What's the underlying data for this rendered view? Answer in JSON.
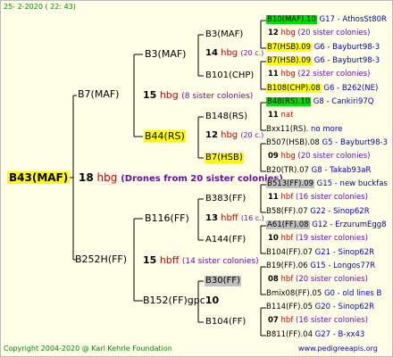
{
  "header": {
    "date": "25-  2-2020 (  22: 43)"
  },
  "footer": {
    "copyright": "Copyright 2004-2020 @ Karl Kehrle Foundation",
    "website": "www.pedigreeapis.org"
  },
  "colors": {
    "yellow": "#ffff00",
    "green": "#00dd00",
    "gray": "#c0c0c0",
    "line": "#000000"
  },
  "root": {
    "name": "B43(MAF)",
    "num": "18",
    "hbg": "hbg",
    "note": "(Drones from 20 sister colonies)"
  },
  "gen1": {
    "top": {
      "name": "B7(MAF)",
      "num": "15",
      "hbg": "hbg",
      "note": "(8 sister colonies)"
    },
    "bottom": {
      "name": "B252H(FF)",
      "num": "15",
      "hbg": "hbff",
      "note": "(14 sister colonies)"
    }
  },
  "gen2": {
    "a": {
      "name": "B3(MAF)",
      "num": "14",
      "hbg": "hbg",
      "note": "(20 c.)"
    },
    "b": {
      "name": "B44(RS)",
      "num": "12",
      "hbg": "hbg",
      "note": "(20 c.)"
    },
    "c": {
      "name": "B116(FF)",
      "num": "13",
      "hbg": "hbff",
      "note": "(16 c.)"
    },
    "d": {
      "name": "B152(FF)gpc",
      "num": "10"
    }
  },
  "gen3": {
    "a1": "B3(MAF)",
    "a2": "B101(CHP)",
    "b1": "B148(RS)",
    "b2": "B7(HSB)",
    "c1": "B383(FF)",
    "c2": "A144(FF)",
    "d1": "B30(FF)",
    "d2": "B104(FF)"
  },
  "gen4": [
    {
      "name": "B10(MAF).10",
      "right": "G17 - AthosSt80R",
      "num": "12",
      "hbg": "hbg",
      "note": "(20 sister colonies)"
    },
    {
      "name": "B7(HSB).09",
      "right": "G6 - Bayburt98-3"
    },
    {
      "name": "B7(HSB).09",
      "right": "G6 - Bayburt98-3",
      "num": "11",
      "hbg": "hbg",
      "note": "(22 sister colonies)"
    },
    {
      "name": "B108(CHP).08",
      "right": "G6 - B262(NE)"
    },
    {
      "name": "B48(RS).10",
      "right": "G8 - Cankiri97Q",
      "num": "11",
      "hbg": "nat"
    },
    {
      "name": "Bxx11(RS).",
      "right": "no more"
    },
    {
      "name": "B507(HSB).08",
      "right": "G5 - Bayburt98-3",
      "num": "09",
      "hbg": "hbg",
      "note": "(20 sister colonies)"
    },
    {
      "name": "B20(TR).07",
      "right": "G8 - Takab93aR"
    },
    {
      "name": "B513(FF).09",
      "right": "G15 - new buckfas",
      "num": "11",
      "hbg": "hbf",
      "note": "(16 sister colonies)"
    },
    {
      "name": "B58(FF).07",
      "right": "G22 - Sinop62R"
    },
    {
      "name": "A61(FF).08",
      "right": "G12 - ErzurumEgg8",
      "num": "10",
      "hbg": "hbf",
      "note": "(19 sister colonies)"
    },
    {
      "name": "B104(FF).07",
      "right": "G21 - Sinop62R"
    },
    {
      "name": "B19(FF).06",
      "right": "G15 - Longos77R",
      "num": "08",
      "hbg": "hbf",
      "note": "(20 sister colonies)"
    },
    {
      "name": "Bmix08(FF).05",
      "right": "G0 - old lines B"
    },
    {
      "name": "B114(FF).05",
      "right": "G20 - Sinop62R",
      "num": "07",
      "hbg": "hbf",
      "note": "(16 sister colonies)"
    },
    {
      "name": "B811(FF).04",
      "right": "G27 - B-xx43"
    }
  ]
}
